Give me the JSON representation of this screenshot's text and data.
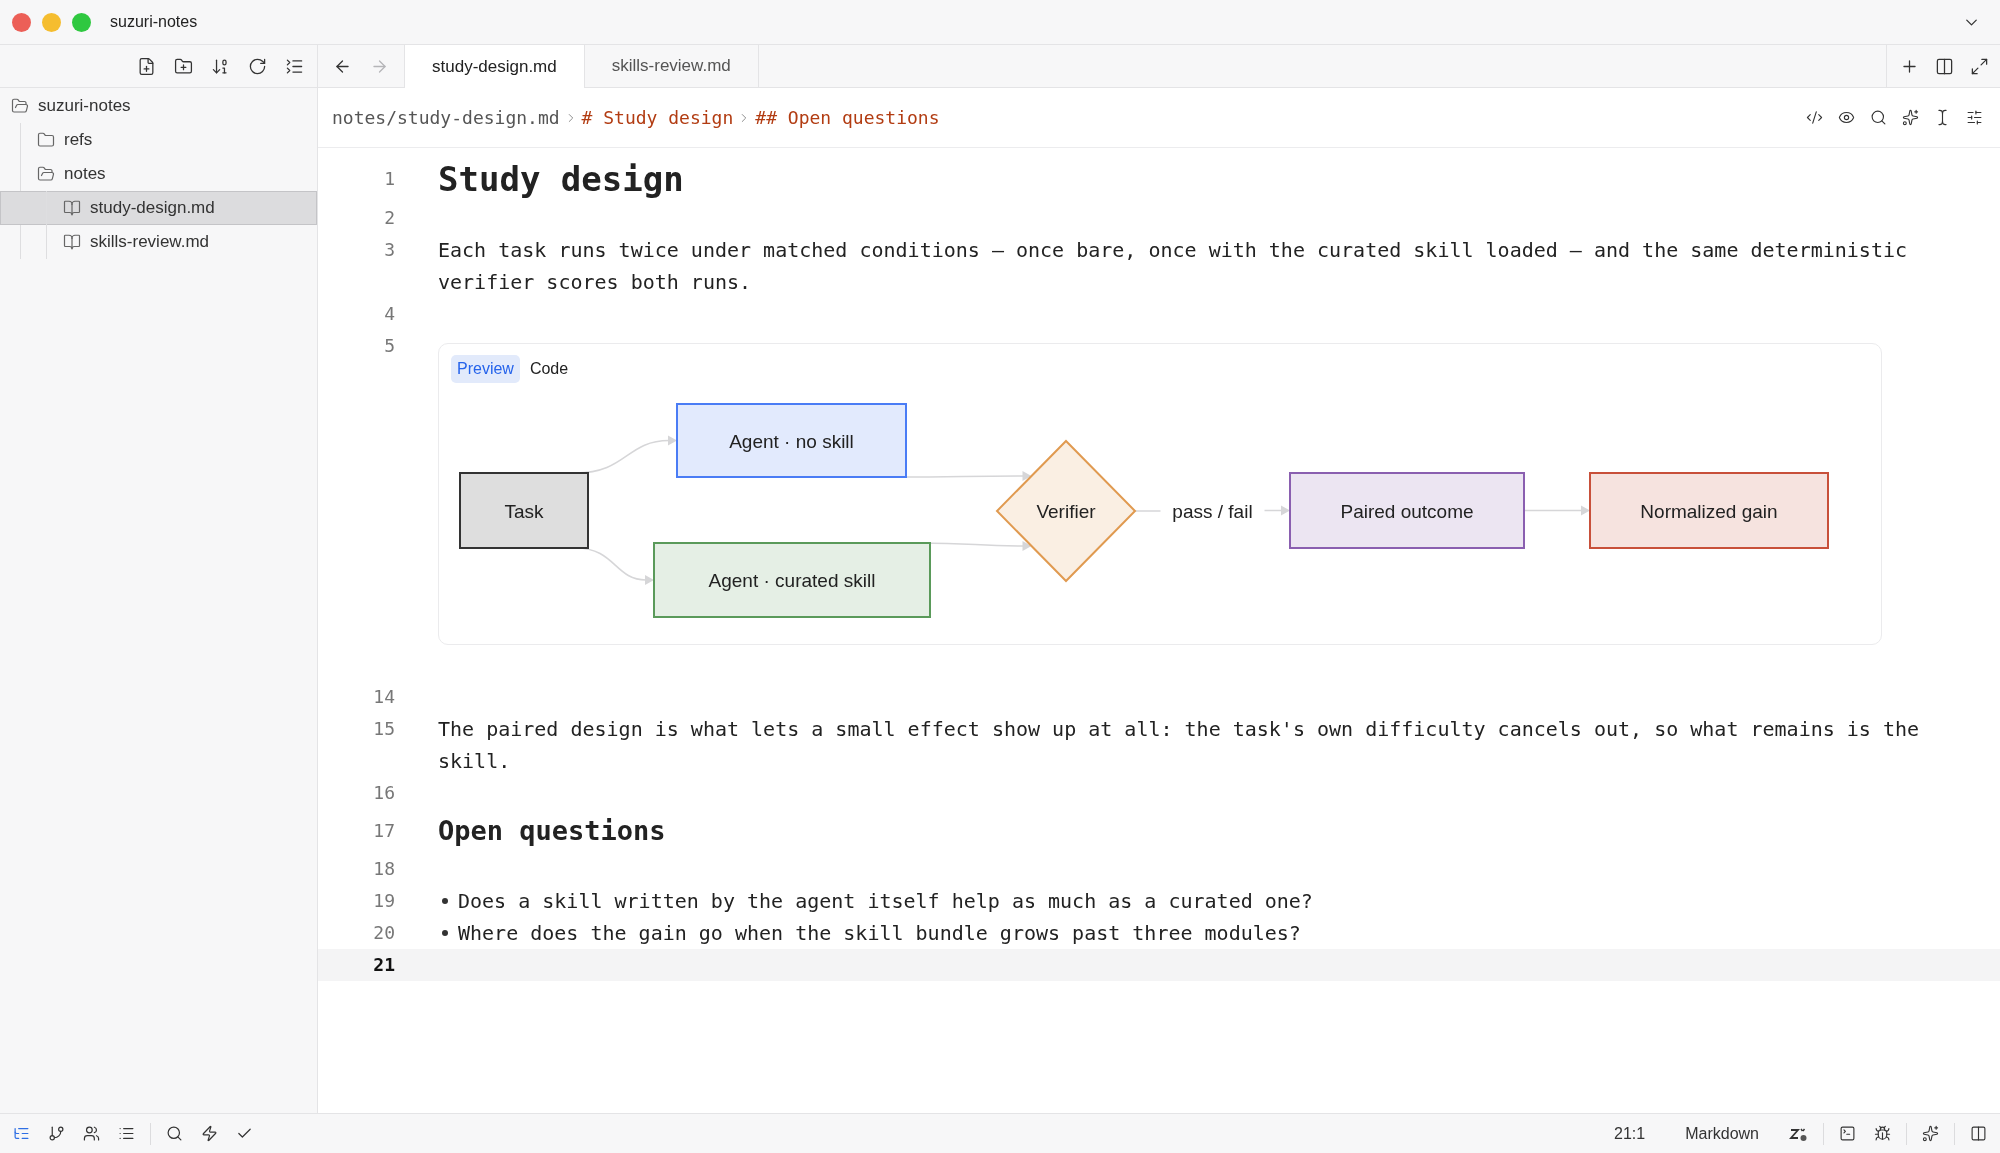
{
  "window": {
    "title": "suzuri-notes"
  },
  "sidebar": {
    "tree": [
      {
        "label": "suzuri-notes",
        "kind": "folder",
        "expanded": true,
        "selected": false,
        "children": [
          {
            "label": "refs",
            "kind": "folder",
            "expanded": false,
            "selected": false
          },
          {
            "label": "notes",
            "kind": "folder",
            "expanded": true,
            "selected": false,
            "children": [
              {
                "label": "study-design.md",
                "kind": "file",
                "selected": true
              },
              {
                "label": "skills-review.md",
                "kind": "file",
                "selected": false
              }
            ]
          }
        ]
      }
    ]
  },
  "nav": {
    "back_disabled": false,
    "forward_disabled": true
  },
  "tabs": [
    {
      "label": "study-design.md",
      "selected": true
    },
    {
      "label": "skills-review.md",
      "selected": false
    }
  ],
  "breadcrumb": [
    {
      "text": "notes/study-design.md",
      "kind": "path"
    },
    {
      "text": "# Study design",
      "kind": "heading"
    },
    {
      "text": "## Open questions",
      "kind": "heading"
    }
  ],
  "editor": {
    "lines": [
      {
        "number": "1",
        "kind": "heading1",
        "text": "Study design",
        "current": false
      },
      {
        "number": "2",
        "kind": "blank",
        "current": false
      },
      {
        "number": "3",
        "kind": "paragraph",
        "text": "Each task runs twice under matched conditions — once bare, once with the curated skill loaded — and the same deterministic verifier scores both runs.",
        "current": false
      },
      {
        "number": "4",
        "kind": "blank",
        "current": false
      },
      {
        "number": "5",
        "kind": "diagram",
        "current": false,
        "diagram": {
          "tabs": [
            {
              "label": "Preview",
              "selected": true
            },
            {
              "label": "Code",
              "selected": false
            }
          ],
          "nodes": [
            {
              "label": "Task",
              "kind": "process",
              "color": "#333333"
            },
            {
              "label": "Agent · no skill",
              "kind": "process",
              "color": "#4a7cf5"
            },
            {
              "label": "Agent · curated skill",
              "kind": "process",
              "color": "#5a9a5a"
            },
            {
              "label": "Verifier",
              "kind": "decision",
              "color": "#e09a50"
            },
            {
              "label": "Paired outcome",
              "kind": "process",
              "color": "#8a5fb0"
            },
            {
              "label": "Normalized gain",
              "kind": "process",
              "color": "#c8503a"
            }
          ],
          "edge_label": "pass / fail"
        }
      },
      {
        "number": "14",
        "kind": "blank",
        "current": false
      },
      {
        "number": "15",
        "kind": "paragraph",
        "text": "The paired design is what lets a small effect show up at all: the task's own difficulty cancels out, so what remains is the skill.",
        "current": false
      },
      {
        "number": "16",
        "kind": "blank",
        "current": false
      },
      {
        "number": "17",
        "kind": "heading2",
        "text": "Open questions",
        "current": false
      },
      {
        "number": "18",
        "kind": "blank",
        "current": false
      },
      {
        "number": "19",
        "kind": "bullet",
        "text": "Does a skill written by the agent itself help as much as a curated one?",
        "current": false
      },
      {
        "number": "20",
        "kind": "bullet",
        "text": "Where does the gain go when the skill bundle grows past three modules?",
        "current": false
      },
      {
        "number": "21",
        "kind": "blank",
        "current": true
      }
    ]
  },
  "status_bar": {
    "panels": [
      {
        "selected": true
      },
      {
        "selected": false
      },
      {
        "selected": false
      },
      {
        "selected": false
      }
    ],
    "position": "21:1",
    "language": "Markdown"
  }
}
